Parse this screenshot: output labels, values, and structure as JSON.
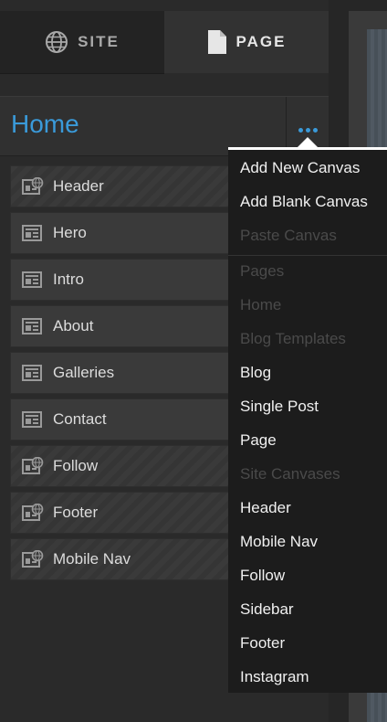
{
  "tabs": {
    "site": "SITE",
    "page": "PAGE"
  },
  "page_title": "Home",
  "canvases": [
    {
      "name": "Header",
      "type": "site"
    },
    {
      "name": "Hero",
      "type": "page"
    },
    {
      "name": "Intro",
      "type": "page"
    },
    {
      "name": "About",
      "type": "page"
    },
    {
      "name": "Galleries",
      "type": "page"
    },
    {
      "name": "Contact",
      "type": "page"
    },
    {
      "name": "Follow",
      "type": "site"
    },
    {
      "name": "Footer",
      "type": "site"
    },
    {
      "name": "Mobile Nav",
      "type": "site"
    }
  ],
  "menu": {
    "add_new_canvas": "Add New Canvas",
    "add_blank_canvas": "Add Blank Canvas",
    "paste_canvas": "Paste Canvas",
    "pages_heading": "Pages",
    "pages_home": "Home",
    "blog_templates_heading": "Blog Templates",
    "blog": "Blog",
    "single_post": "Single Post",
    "page": "Page",
    "site_canvases_heading": "Site Canvases",
    "header": "Header",
    "mobile_nav": "Mobile Nav",
    "follow": "Follow",
    "sidebar": "Sidebar",
    "footer": "Footer",
    "instagram": "Instagram"
  },
  "colors": {
    "accent": "#3a9ad9",
    "menu_bg": "#1c1c1c",
    "disabled_text": "#4a4a4a"
  },
  "icons": {
    "site_tab": "globe-icon",
    "page_tab": "document-icon",
    "page_canvas": "page-canvas-icon",
    "site_canvas": "site-canvas-icon",
    "more": "more-dots-icon"
  }
}
